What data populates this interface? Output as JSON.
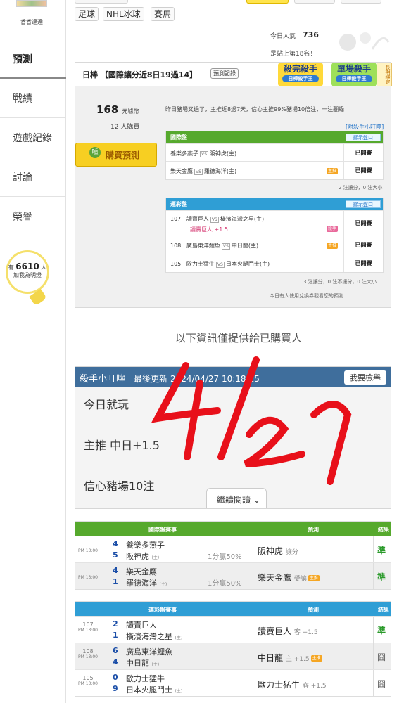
{
  "sidebar": {
    "user_name": "香香達達",
    "nav": [
      "預測",
      "戰績",
      "遊戲紀錄",
      "討論",
      "榮譽"
    ],
    "helper": {
      "prefix": "有",
      "count": "6610",
      "suffix": "人",
      "line2": "加我為明燈"
    }
  },
  "tags": [
    "足球",
    "NHL冰球",
    "賽馬"
  ],
  "stats": {
    "pop_label": "今日人氣",
    "pop_value": "736",
    "rank_text": "是站上第18名！"
  },
  "panel": {
    "title": "日棒 【國際讓分近8日19過14】",
    "record_btn": "預測記錄",
    "badge1": {
      "title": "殺完殺手",
      "sub": "日棒殺手王"
    },
    "badge2": {
      "title": "單場殺手",
      "sub": "日棒殺手王"
    },
    "ribbon": "長期穩定",
    "price": "168",
    "price_unit": "元噱幣",
    "buyers": "12 人購買",
    "buy_label": "購買預測",
    "buy_icon": "噱",
    "desc": "昨日豬場又過了，主推近8過7天，信心主推99%豬場10倍注，一注翻綠",
    "link": "[附殺手小叮嚀]",
    "intl": {
      "header": "國際盤",
      "show_btn": "顯示盤口",
      "rows": [
        {
          "away": "養樂多燕子",
          "home": "阪神虎(主)",
          "status": "已開賽"
        },
        {
          "away": "樂天金鷹",
          "home": "羅德海洋(主)",
          "status": "已開賽",
          "hot": "主推"
        }
      ],
      "footer": "2 注讓分，0 注大小"
    },
    "lottery": {
      "header": "運彩盤",
      "show_btn": "顯示盤口",
      "rows": [
        {
          "no": "107",
          "away": "讀賣巨人",
          "home": "橫濱海灣之星(主)",
          "pick": "讀賣巨人 +1.5",
          "status": "已開賽",
          "hot": "殺手"
        },
        {
          "no": "108",
          "away": "廣島東洋鯉魚",
          "home": "中日龍(主)",
          "status": "已開賽",
          "hot": "主推"
        },
        {
          "no": "105",
          "away": "歐力士猛牛",
          "home": "日本火腿鬥士(主)",
          "status": "已開賽"
        }
      ],
      "footer": "3 注讓分，0 注不讓分，0 注大小"
    },
    "redeem": "今日有人使用兌換券觀看您的預測"
  },
  "info_text": "以下資訊僅提供給已購買人",
  "article": {
    "title": "殺手小叮嚀",
    "updated": "最後更新 2024/04/27 10:18:15",
    "report_btn": "我要檢舉",
    "line1": "今日就玩",
    "line2": "主推 中日+1.5",
    "line3": "信心豬場10注",
    "continue": "繼續閱讀"
  },
  "intl_table": {
    "headers": [
      "國際盤賽事",
      "預測",
      "結果"
    ],
    "rows": [
      {
        "time": "PM 13:00",
        "s1": "4",
        "t1": "養樂多燕子",
        "s2": "5",
        "t2": "阪神虎",
        "host": "(主)",
        "pct": "",
        "pred": "阪神虎",
        "pred_sub": "讓分",
        "result": "準"
      },
      {
        "time": "PM 13:00",
        "s1": "4",
        "t1": "樂天金鷹",
        "s2": "1",
        "t2": "羅德海洋",
        "host": "(主)",
        "pct": "1分贏50%",
        "pred": "樂天金鷹",
        "pred_sub": "受讓",
        "hot": "主推",
        "result": "準"
      }
    ],
    "row1_pct": "1分贏50%"
  },
  "lottery_table": {
    "headers": [
      "運彩盤賽事",
      "預測",
      "結果"
    ],
    "rows": [
      {
        "no": "107",
        "time": "PM 13:00",
        "s1": "2",
        "t1": "讀賣巨人",
        "s2": "1",
        "t2": "橫濱海灣之星",
        "host": "(主)",
        "pred": "讀賣巨人",
        "pred_sub": "客 +1.5",
        "result": "準"
      },
      {
        "no": "108",
        "time": "PM 13:00",
        "s1": "6",
        "t1": "廣島東洋鯉魚",
        "s2": "4",
        "t2": "中日龍",
        "host": "(主)",
        "pred": "中日龍",
        "pred_sub": "主 +1.5",
        "hot": "主推",
        "result": "囧"
      },
      {
        "no": "105",
        "time": "PM 13:00",
        "s1": "0",
        "t1": "歐力士猛牛",
        "s2": "9",
        "t2": "日本火腿鬥士",
        "host": "(主)",
        "pred": "歐力士猛牛",
        "pred_sub": "客 +1.5",
        "result": "囧"
      }
    ]
  },
  "handwriting": "4/27",
  "colors": {
    "green": "#56a92d",
    "blue": "#2f9ed5",
    "gold": "#f7cf22",
    "ink": "#e8101a"
  }
}
